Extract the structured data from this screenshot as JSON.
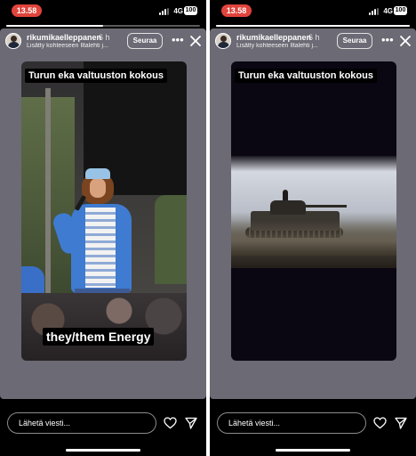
{
  "status_bar": {
    "time": "13.58",
    "network": "4G",
    "battery": "100"
  },
  "stories": [
    {
      "username": "rikumikaelleppanen",
      "time_ago": "6 h",
      "subline": "Lisätty kohteeseen Iltalehti j...",
      "follow_label": "Seuraa",
      "caption_top": "Turun eka valtuuston kokous",
      "caption_bottom": "they/them Energy",
      "progress": 0.5
    },
    {
      "username": "rikumikaelleppanen",
      "time_ago": "6 h",
      "subline": "Lisätty kohteeseen Iltalehti j...",
      "follow_label": "Seuraa",
      "caption_top": "Turun eka valtuuston kokous",
      "progress": 1.0
    }
  ],
  "message_placeholder": "Lähetä viesti...",
  "icons": {
    "more": "more-icon",
    "close": "close-icon",
    "like": "heart-icon",
    "send": "send-icon"
  },
  "colors": {
    "time_pill": "#e0443c",
    "story_bg": "#6c6a74"
  }
}
